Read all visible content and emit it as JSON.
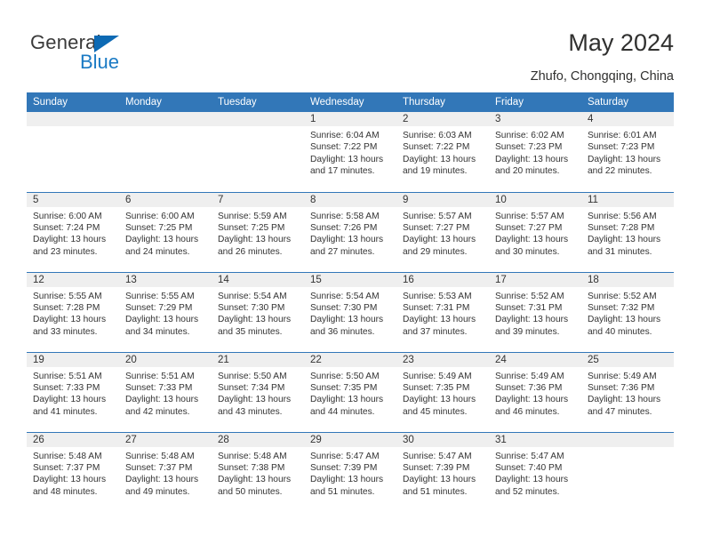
{
  "brand": {
    "name_part1": "General",
    "name_part2": "Blue",
    "triangle_color": "#0d6ab4",
    "blue_color": "#1a7ac4"
  },
  "header": {
    "title": "May 2024",
    "subtitle": "Zhufo, Chongqing, China"
  },
  "theme": {
    "header_bg": "#3277b8",
    "header_text": "#ffffff",
    "daynum_bg": "#efefef",
    "separator": "#3277b8",
    "body_text": "#333333"
  },
  "weekdays": [
    "Sunday",
    "Monday",
    "Tuesday",
    "Wednesday",
    "Thursday",
    "Friday",
    "Saturday"
  ],
  "weeks": [
    [
      {
        "day": "",
        "empty": true
      },
      {
        "day": "",
        "empty": true
      },
      {
        "day": "",
        "empty": true
      },
      {
        "day": "1",
        "sunrise": "Sunrise: 6:04 AM",
        "sunset": "Sunset: 7:22 PM",
        "daylight1": "Daylight: 13 hours",
        "daylight2": "and 17 minutes."
      },
      {
        "day": "2",
        "sunrise": "Sunrise: 6:03 AM",
        "sunset": "Sunset: 7:22 PM",
        "daylight1": "Daylight: 13 hours",
        "daylight2": "and 19 minutes."
      },
      {
        "day": "3",
        "sunrise": "Sunrise: 6:02 AM",
        "sunset": "Sunset: 7:23 PM",
        "daylight1": "Daylight: 13 hours",
        "daylight2": "and 20 minutes."
      },
      {
        "day": "4",
        "sunrise": "Sunrise: 6:01 AM",
        "sunset": "Sunset: 7:23 PM",
        "daylight1": "Daylight: 13 hours",
        "daylight2": "and 22 minutes."
      }
    ],
    [
      {
        "day": "5",
        "sunrise": "Sunrise: 6:00 AM",
        "sunset": "Sunset: 7:24 PM",
        "daylight1": "Daylight: 13 hours",
        "daylight2": "and 23 minutes."
      },
      {
        "day": "6",
        "sunrise": "Sunrise: 6:00 AM",
        "sunset": "Sunset: 7:25 PM",
        "daylight1": "Daylight: 13 hours",
        "daylight2": "and 24 minutes."
      },
      {
        "day": "7",
        "sunrise": "Sunrise: 5:59 AM",
        "sunset": "Sunset: 7:25 PM",
        "daylight1": "Daylight: 13 hours",
        "daylight2": "and 26 minutes."
      },
      {
        "day": "8",
        "sunrise": "Sunrise: 5:58 AM",
        "sunset": "Sunset: 7:26 PM",
        "daylight1": "Daylight: 13 hours",
        "daylight2": "and 27 minutes."
      },
      {
        "day": "9",
        "sunrise": "Sunrise: 5:57 AM",
        "sunset": "Sunset: 7:27 PM",
        "daylight1": "Daylight: 13 hours",
        "daylight2": "and 29 minutes."
      },
      {
        "day": "10",
        "sunrise": "Sunrise: 5:57 AM",
        "sunset": "Sunset: 7:27 PM",
        "daylight1": "Daylight: 13 hours",
        "daylight2": "and 30 minutes."
      },
      {
        "day": "11",
        "sunrise": "Sunrise: 5:56 AM",
        "sunset": "Sunset: 7:28 PM",
        "daylight1": "Daylight: 13 hours",
        "daylight2": "and 31 minutes."
      }
    ],
    [
      {
        "day": "12",
        "sunrise": "Sunrise: 5:55 AM",
        "sunset": "Sunset: 7:28 PM",
        "daylight1": "Daylight: 13 hours",
        "daylight2": "and 33 minutes."
      },
      {
        "day": "13",
        "sunrise": "Sunrise: 5:55 AM",
        "sunset": "Sunset: 7:29 PM",
        "daylight1": "Daylight: 13 hours",
        "daylight2": "and 34 minutes."
      },
      {
        "day": "14",
        "sunrise": "Sunrise: 5:54 AM",
        "sunset": "Sunset: 7:30 PM",
        "daylight1": "Daylight: 13 hours",
        "daylight2": "and 35 minutes."
      },
      {
        "day": "15",
        "sunrise": "Sunrise: 5:54 AM",
        "sunset": "Sunset: 7:30 PM",
        "daylight1": "Daylight: 13 hours",
        "daylight2": "and 36 minutes."
      },
      {
        "day": "16",
        "sunrise": "Sunrise: 5:53 AM",
        "sunset": "Sunset: 7:31 PM",
        "daylight1": "Daylight: 13 hours",
        "daylight2": "and 37 minutes."
      },
      {
        "day": "17",
        "sunrise": "Sunrise: 5:52 AM",
        "sunset": "Sunset: 7:31 PM",
        "daylight1": "Daylight: 13 hours",
        "daylight2": "and 39 minutes."
      },
      {
        "day": "18",
        "sunrise": "Sunrise: 5:52 AM",
        "sunset": "Sunset: 7:32 PM",
        "daylight1": "Daylight: 13 hours",
        "daylight2": "and 40 minutes."
      }
    ],
    [
      {
        "day": "19",
        "sunrise": "Sunrise: 5:51 AM",
        "sunset": "Sunset: 7:33 PM",
        "daylight1": "Daylight: 13 hours",
        "daylight2": "and 41 minutes."
      },
      {
        "day": "20",
        "sunrise": "Sunrise: 5:51 AM",
        "sunset": "Sunset: 7:33 PM",
        "daylight1": "Daylight: 13 hours",
        "daylight2": "and 42 minutes."
      },
      {
        "day": "21",
        "sunrise": "Sunrise: 5:50 AM",
        "sunset": "Sunset: 7:34 PM",
        "daylight1": "Daylight: 13 hours",
        "daylight2": "and 43 minutes."
      },
      {
        "day": "22",
        "sunrise": "Sunrise: 5:50 AM",
        "sunset": "Sunset: 7:35 PM",
        "daylight1": "Daylight: 13 hours",
        "daylight2": "and 44 minutes."
      },
      {
        "day": "23",
        "sunrise": "Sunrise: 5:49 AM",
        "sunset": "Sunset: 7:35 PM",
        "daylight1": "Daylight: 13 hours",
        "daylight2": "and 45 minutes."
      },
      {
        "day": "24",
        "sunrise": "Sunrise: 5:49 AM",
        "sunset": "Sunset: 7:36 PM",
        "daylight1": "Daylight: 13 hours",
        "daylight2": "and 46 minutes."
      },
      {
        "day": "25",
        "sunrise": "Sunrise: 5:49 AM",
        "sunset": "Sunset: 7:36 PM",
        "daylight1": "Daylight: 13 hours",
        "daylight2": "and 47 minutes."
      }
    ],
    [
      {
        "day": "26",
        "sunrise": "Sunrise: 5:48 AM",
        "sunset": "Sunset: 7:37 PM",
        "daylight1": "Daylight: 13 hours",
        "daylight2": "and 48 minutes."
      },
      {
        "day": "27",
        "sunrise": "Sunrise: 5:48 AM",
        "sunset": "Sunset: 7:37 PM",
        "daylight1": "Daylight: 13 hours",
        "daylight2": "and 49 minutes."
      },
      {
        "day": "28",
        "sunrise": "Sunrise: 5:48 AM",
        "sunset": "Sunset: 7:38 PM",
        "daylight1": "Daylight: 13 hours",
        "daylight2": "and 50 minutes."
      },
      {
        "day": "29",
        "sunrise": "Sunrise: 5:47 AM",
        "sunset": "Sunset: 7:39 PM",
        "daylight1": "Daylight: 13 hours",
        "daylight2": "and 51 minutes."
      },
      {
        "day": "30",
        "sunrise": "Sunrise: 5:47 AM",
        "sunset": "Sunset: 7:39 PM",
        "daylight1": "Daylight: 13 hours",
        "daylight2": "and 51 minutes."
      },
      {
        "day": "31",
        "sunrise": "Sunrise: 5:47 AM",
        "sunset": "Sunset: 7:40 PM",
        "daylight1": "Daylight: 13 hours",
        "daylight2": "and 52 minutes."
      },
      {
        "day": "",
        "empty": true
      }
    ]
  ]
}
